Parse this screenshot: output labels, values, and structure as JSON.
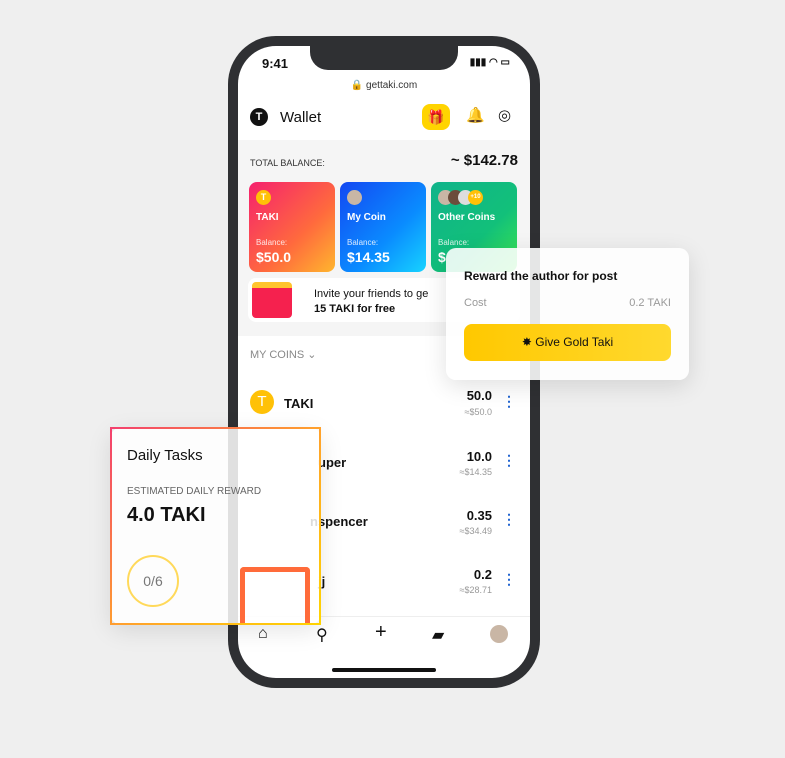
{
  "status": {
    "time": "9:41",
    "url": "gettaki.com"
  },
  "header": {
    "logo": "T",
    "title": "Wallet",
    "icons": [
      "gift-icon",
      "bell-icon",
      "coin-icon"
    ]
  },
  "balance": {
    "label": "TOTAL BALANCE:",
    "value": "~ $142.78"
  },
  "cards": [
    {
      "name": "TAKI",
      "icon": "T",
      "balance_label": "Balance:",
      "balance": "$50.0"
    },
    {
      "name": "My Coin",
      "balance_label": "Balance:",
      "balance": "$14.35"
    },
    {
      "name": "Other Coins",
      "badge": "+10",
      "balance_label": "Balance:",
      "balance": "$"
    }
  ],
  "invite": {
    "line1": "Invite your friends to ge",
    "line2": "15 TAKI for free"
  },
  "my_coins": {
    "label": "MY COINS",
    "rows": [
      {
        "name": "TAKI",
        "amount": "50.0",
        "usd": "≈$50.0"
      },
      {
        "name": "uper",
        "amount": "10.0",
        "usd": "≈$14.35"
      },
      {
        "name": "nspencer",
        "amount": "0.35",
        "usd": "≈$34.49"
      },
      {
        "name": "jj",
        "amount": "0.2",
        "usd": "≈$28.71"
      }
    ]
  },
  "reward": {
    "title": "Reward the author for post",
    "cost_label": "Cost",
    "cost": "0.2 TAKI",
    "button": "Give Gold Taki"
  },
  "daily": {
    "title": "Daily Tasks",
    "label": "ESTIMATED DAILY REWARD",
    "value": "4.0 TAKI",
    "progress": "0/6"
  },
  "colors": {
    "accent": "#ffd400",
    "link": "#2366d1"
  }
}
